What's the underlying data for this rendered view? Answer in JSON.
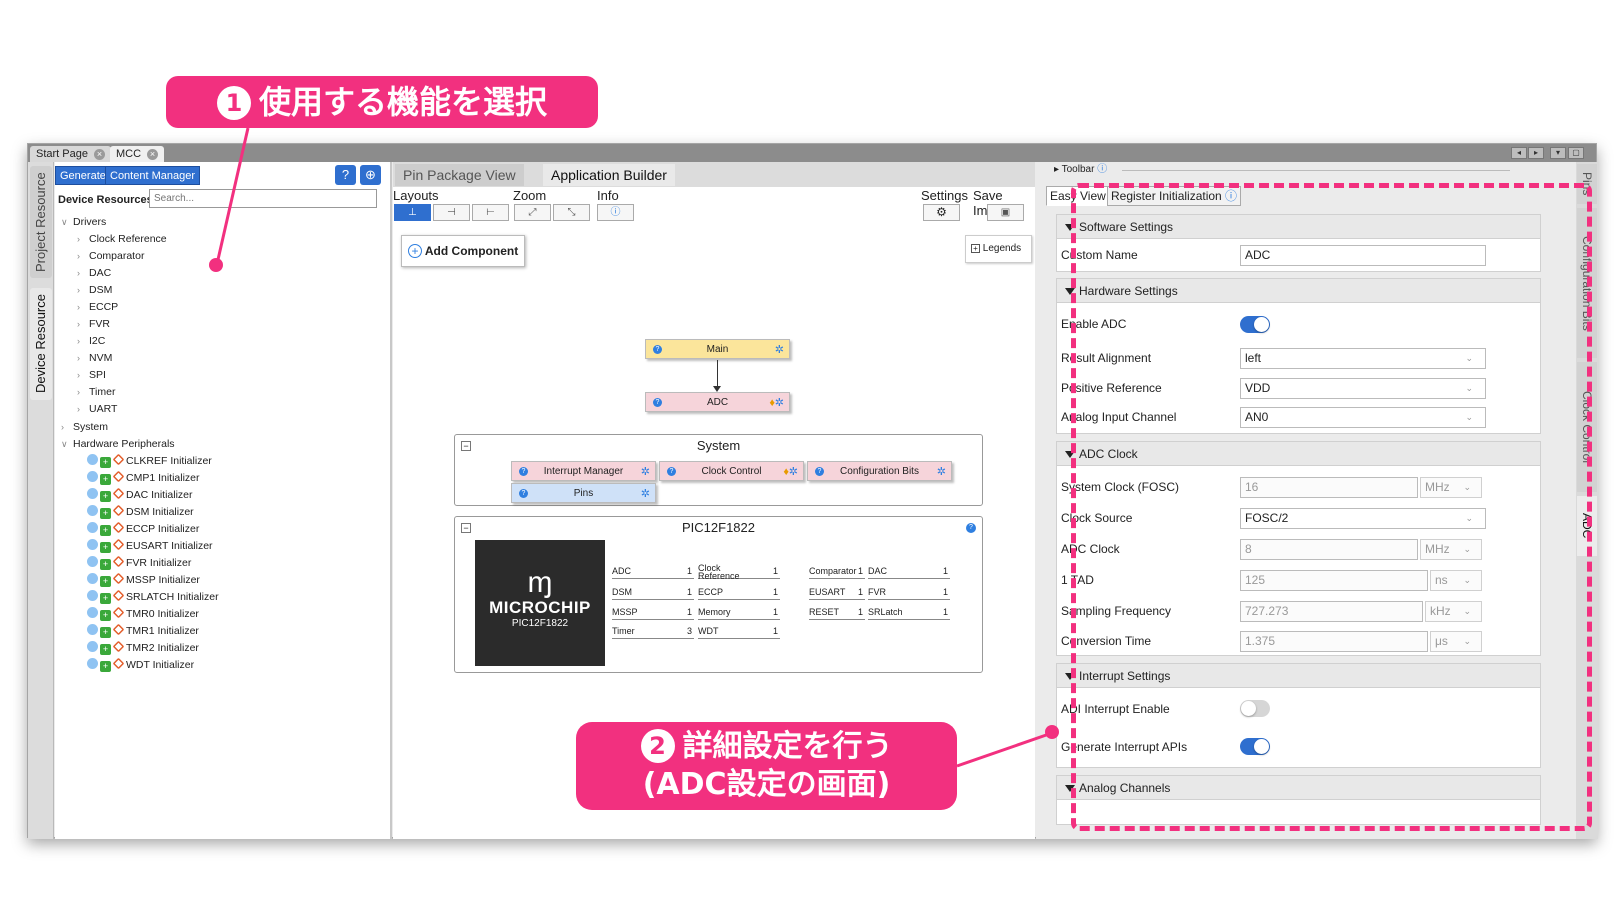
{
  "callouts": {
    "step1": {
      "num": "1",
      "text": "使用する機能を選択"
    },
    "step2": {
      "num": "2",
      "line1": "詳細設定を行う",
      "line2": "(ADC設定の画面)"
    }
  },
  "window": {
    "tabs": [
      {
        "label": "Start Page"
      },
      {
        "label": "MCC"
      }
    ],
    "controls": [
      "◂",
      "▸",
      "▾",
      "▢"
    ]
  },
  "left_vtabs": {
    "project": "Project Resource",
    "device": "Device Resource"
  },
  "resources": {
    "generate": "Generate",
    "content_manager": "Content Manager",
    "help_icon": "?",
    "globe_icon": "⊕",
    "title": "Device Resources",
    "search_placeholder": "Search...",
    "drivers_label": "Drivers",
    "drivers": [
      "Clock Reference",
      "Comparator",
      "DAC",
      "DSM",
      "ECCP",
      "FVR",
      "I2C",
      "NVM",
      "SPI",
      "Timer",
      "UART"
    ],
    "system_label": "System",
    "hw_label": "Hardware Peripherals",
    "hw_items": [
      "CLKREF Initializer",
      "CMP1 Initializer",
      "DAC Initializer",
      "DSM Initializer",
      "ECCP Initializer",
      "EUSART Initializer",
      "FVR Initializer",
      "MSSP Initializer",
      "SRLATCH Initializer",
      "TMR0 Initializer",
      "TMR1 Initializer",
      "TMR2 Initializer",
      "WDT Initializer"
    ]
  },
  "center": {
    "tabs": {
      "pin": "Pin Package View",
      "app": "Application Builder"
    },
    "toolbar": {
      "layouts": "Layouts",
      "zoom": "Zoom",
      "info": "Info",
      "settings": "Settings",
      "save_image": "Save Image"
    },
    "add_component": "Add Component",
    "legends": "Legends",
    "nodes": {
      "main": "Main",
      "adc": "ADC"
    },
    "system": {
      "title": "System",
      "items": [
        "Interrupt Manager",
        "Clock Control",
        "Configuration Bits",
        "Pins"
      ]
    },
    "device": {
      "title": "PIC12F1822",
      "chip_brand": "MICROCHIP",
      "chip_part": "PIC12F1822",
      "table": [
        [
          {
            "label": "ADC",
            "count": "1"
          },
          {
            "label": "Clock Reference",
            "count": "1"
          },
          {
            "label": "Comparator",
            "count": "1"
          },
          {
            "label": "DAC",
            "count": "1"
          }
        ],
        [
          {
            "label": "DSM",
            "count": "1"
          },
          {
            "label": "ECCP",
            "count": "1"
          },
          {
            "label": "EUSART",
            "count": "1"
          },
          {
            "label": "FVR",
            "count": "1"
          }
        ],
        [
          {
            "label": "MSSP",
            "count": "1"
          },
          {
            "label": "Memory",
            "count": "1"
          },
          {
            "label": "RESET",
            "count": "1"
          },
          {
            "label": "SRLatch",
            "count": "1"
          }
        ],
        [
          {
            "label": "Timer",
            "count": "3"
          },
          {
            "label": "WDT",
            "count": "1"
          }
        ]
      ]
    }
  },
  "right": {
    "toolbar": "Toolbar",
    "tabs": {
      "easy": "Easy View",
      "register": "Register Initialization"
    },
    "vtabs": [
      "Pins",
      "Configuration Bits",
      "Clock Control",
      "ADC"
    ],
    "software": {
      "title": "Software Settings",
      "custom_name_label": "Custom Name",
      "custom_name": "ADC"
    },
    "hardware": {
      "title": "Hardware Settings",
      "enable_adc": "Enable ADC",
      "result_alignment_label": "Result Alignment",
      "result_alignment": "left",
      "positive_reference_label": "Positive Reference",
      "positive_reference": "VDD",
      "analog_input_label": "Analog Input Channel",
      "analog_input": "AN0"
    },
    "adc_clock": {
      "title": "ADC Clock",
      "system_clock_label": "System Clock (FOSC)",
      "system_clock": "16",
      "system_clock_unit": "MHz",
      "clock_source_label": "Clock Source",
      "clock_source": "FOSC/2",
      "adc_clock_label": "ADC Clock",
      "adc_clock": "8",
      "adc_clock_unit": "MHz",
      "tad_label": "1 TAD",
      "tad": "125",
      "tad_unit": "ns",
      "sampling_label": "Sampling Frequency",
      "sampling": "727.273",
      "sampling_unit": "kHz",
      "conversion_label": "Conversion Time",
      "conversion": "1.375",
      "conversion_unit": "μs"
    },
    "interrupt": {
      "title": "Interrupt Settings",
      "adi_label": "ADI Interrupt Enable",
      "gen_label": "Generate Interrupt APIs"
    },
    "analog_channels": {
      "title": "Analog Channels"
    }
  },
  "colors": {
    "accent": "#f2307f",
    "primary": "#2f6fcf"
  }
}
